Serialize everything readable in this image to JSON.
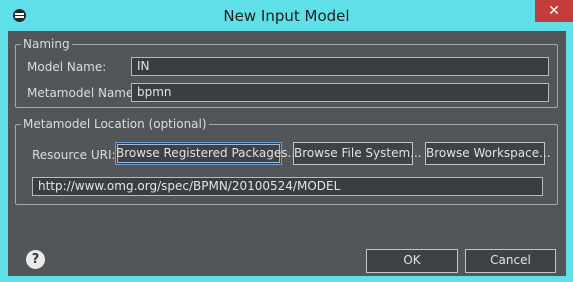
{
  "window": {
    "title": "New Input Model"
  },
  "naming": {
    "legend": "Naming",
    "model_name_label": "Model Name:",
    "model_name_value": "IN",
    "metamodel_name_label": "Metamodel Name:",
    "metamodel_name_value": "bpmn"
  },
  "location": {
    "legend": "Metamodel Location (optional)",
    "resource_uri_label": "Resource URI:",
    "browse_packages_label": "Browse Registered Packages...",
    "browse_filesystem_label": "Browse File System...",
    "browse_workspace_label": "Browse Workspace...",
    "uri_value": "http://www.omg.org/spec/BPMN/20100524/MODEL"
  },
  "footer": {
    "ok_label": "OK",
    "cancel_label": "Cancel"
  },
  "icons": {
    "help": "help-icon",
    "app": "eclipse-icon",
    "close": "close-icon"
  }
}
